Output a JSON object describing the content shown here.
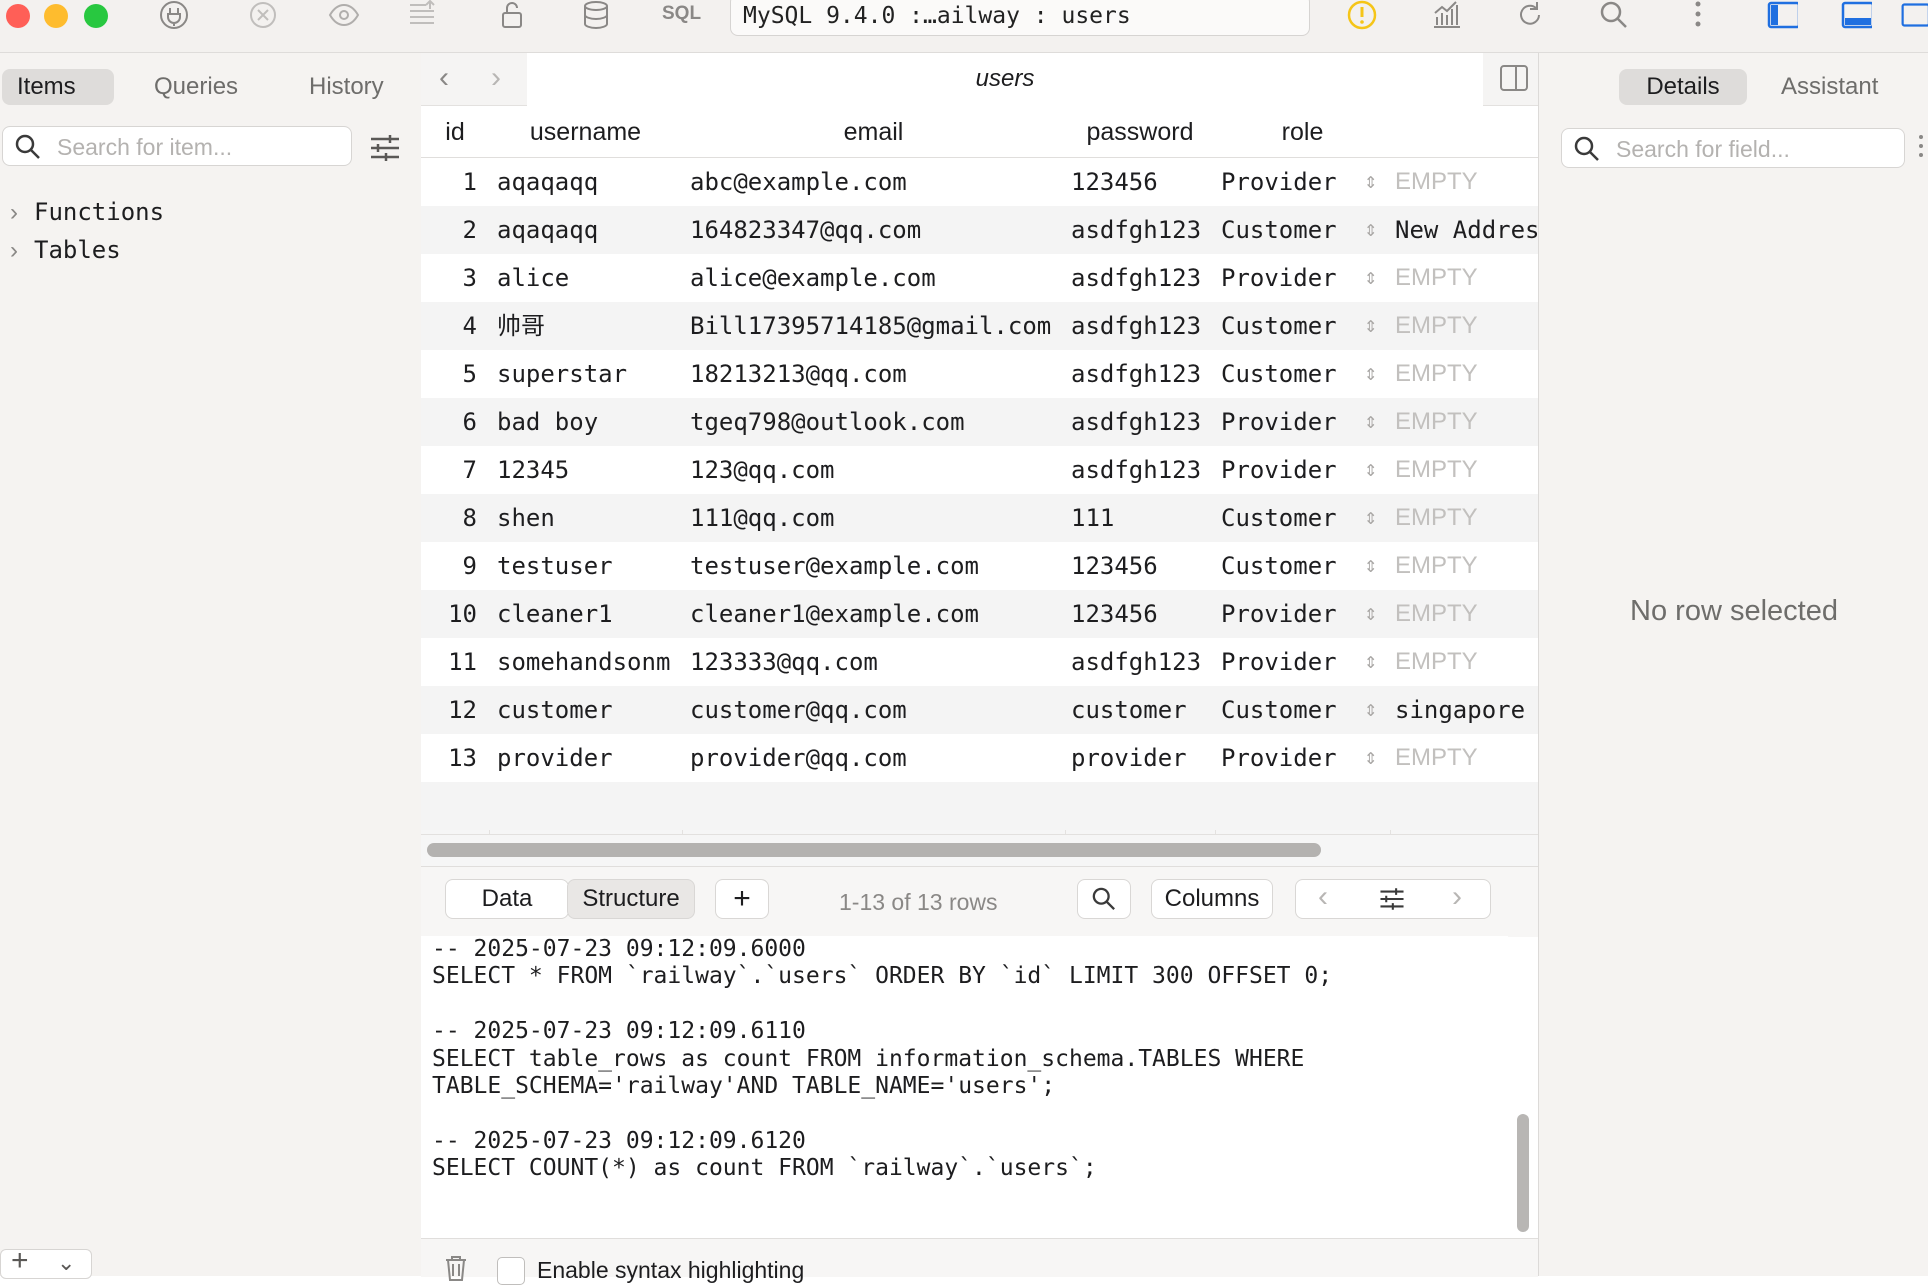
{
  "toolbar": {
    "connection": "MySQL 9.4.0 :…ailway : users",
    "sql_label": "SQL"
  },
  "sidebar": {
    "tabs": [
      "Items",
      "Queries",
      "History"
    ],
    "search_placeholder": "Search for item...",
    "tree": [
      "Functions",
      "Tables"
    ]
  },
  "table": {
    "title": "users",
    "columns": [
      "id",
      "username",
      "email",
      "password",
      "role"
    ],
    "rows": [
      {
        "id": "1",
        "username": "aqaqaqq",
        "email": "abc@example.com",
        "password": "123456",
        "role": "Provider",
        "address": "EMPTY"
      },
      {
        "id": "2",
        "username": "aqaqaqq",
        "email": "164823347@qq.com",
        "password": "asdfgh123",
        "role": "Customer",
        "address": "New Addres"
      },
      {
        "id": "3",
        "username": "alice",
        "email": "alice@example.com",
        "password": "asdfgh123",
        "role": "Provider",
        "address": "EMPTY"
      },
      {
        "id": "4",
        "username": "帅哥",
        "email": "Bill17395714185@gmail.com",
        "password": "asdfgh123",
        "role": "Customer",
        "address": "EMPTY"
      },
      {
        "id": "5",
        "username": "superstar",
        "email": "18213213@qq.com",
        "password": "asdfgh123",
        "role": "Customer",
        "address": "EMPTY"
      },
      {
        "id": "6",
        "username": "bad boy",
        "email": "tgeq798@outlook.com",
        "password": "asdfgh123",
        "role": "Provider",
        "address": "EMPTY"
      },
      {
        "id": "7",
        "username": "12345",
        "email": "123@qq.com",
        "password": "asdfgh123",
        "role": "Provider",
        "address": "EMPTY"
      },
      {
        "id": "8",
        "username": "shen",
        "email": "111@qq.com",
        "password": "111",
        "role": "Customer",
        "address": "EMPTY"
      },
      {
        "id": "9",
        "username": "testuser",
        "email": "testuser@example.com",
        "password": "123456",
        "role": "Customer",
        "address": "EMPTY"
      },
      {
        "id": "10",
        "username": "cleaner1",
        "email": "cleaner1@example.com",
        "password": "123456",
        "role": "Provider",
        "address": "EMPTY"
      },
      {
        "id": "11",
        "username": "somehandsonm",
        "email": "123333@qq.com",
        "password": "asdfgh123",
        "role": "Provider",
        "address": "EMPTY"
      },
      {
        "id": "12",
        "username": "customer",
        "email": "customer@qq.com",
        "password": "customer",
        "role": "Customer",
        "address": "singapore"
      },
      {
        "id": "13",
        "username": "provider",
        "email": "provider@qq.com",
        "password": "provider",
        "role": "Provider",
        "address": "EMPTY"
      }
    ]
  },
  "bottom_bar": {
    "data_label": "Data",
    "structure_label": "Structure",
    "rows_text": "1-13 of 13 rows",
    "columns_label": "Columns"
  },
  "console": {
    "lines": [
      "-- 2025-07-23 09:12:09.6000",
      "SELECT * FROM `railway`.`users` ORDER BY `id` LIMIT 300 OFFSET 0;",
      "",
      "-- 2025-07-23 09:12:09.6110",
      "SELECT table_rows as count FROM information_schema.TABLES WHERE",
      "TABLE_SCHEMA='railway'AND TABLE_NAME='users';",
      "",
      "-- 2025-07-23 09:12:09.6120",
      "SELECT COUNT(*) as count FROM `railway`.`users`;"
    ],
    "syntax_label": "Enable syntax highlighting"
  },
  "right_panel": {
    "tabs": [
      "Details",
      "Assistant"
    ],
    "search_placeholder": "Search for field...",
    "empty_message": "No row selected"
  },
  "colors": {
    "traffic_red": "#ff5f57",
    "traffic_yellow": "#febc2e",
    "traffic_green": "#28c840",
    "warning": "#f5c518",
    "accent": "#1f6fe0"
  }
}
